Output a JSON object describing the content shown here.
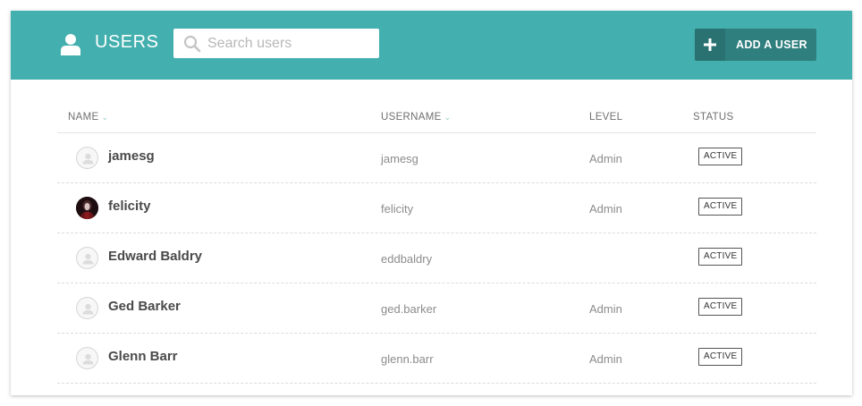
{
  "header": {
    "title": "USERS",
    "search": {
      "placeholder": "Search users",
      "value": ""
    },
    "add_button_label": "ADD A USER",
    "colors": {
      "bar": "#43afae",
      "button": "#2f7f7e"
    }
  },
  "table": {
    "columns": {
      "name": "NAME",
      "username": "USERNAME",
      "level": "LEVEL",
      "status": "STATUS"
    },
    "rows": [
      {
        "name": "jamesg",
        "username": "jamesg",
        "level": "Admin",
        "status": "ACTIVE",
        "avatar": "placeholder-avatar-icon"
      },
      {
        "name": "felicity",
        "username": "felicity",
        "level": "Admin",
        "status": "ACTIVE",
        "avatar": "photo-avatar"
      },
      {
        "name": "Edward Baldry",
        "username": "eddbaldry",
        "level": "",
        "status": "ACTIVE",
        "avatar": "placeholder-avatar-icon"
      },
      {
        "name": "Ged Barker",
        "username": "ged.barker",
        "level": "Admin",
        "status": "ACTIVE",
        "avatar": "placeholder-avatar-icon"
      },
      {
        "name": "Glenn Barr",
        "username": "glenn.barr",
        "level": "Admin",
        "status": "ACTIVE",
        "avatar": "placeholder-avatar-icon"
      }
    ]
  }
}
